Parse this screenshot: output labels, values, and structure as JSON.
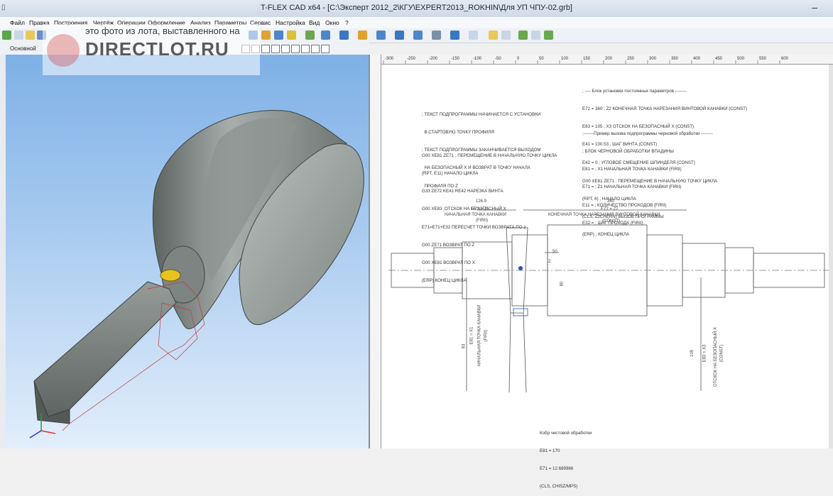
{
  "window": {
    "title": "T-FLEX CAD x64 - [С:\\Эксперт 2012_2\\КГУ\\EXPERT2013_ROKHIN\\Для УП ЧПУ-02.grb]",
    "minimize_glyph": "–"
  },
  "menu": {
    "items": [
      "Файл",
      "Правка",
      "Построения",
      "Чертёж",
      "Операции",
      "Оформление",
      "Анализ",
      "Параметры",
      "Сервис",
      "Настройка",
      "Вид",
      "Окно",
      "?"
    ]
  },
  "toolbar2": {
    "layer_label": "Основной"
  },
  "watermark": {
    "caption": "это фото из лота, выставленного на",
    "logo": "DIRECTLOT.RU"
  },
  "ruler": {
    "ticks": [
      "-300",
      "-250",
      "-200",
      "-150",
      "-100",
      "-50",
      "0",
      "50",
      "100",
      "150",
      "200",
      "250",
      "300",
      "350",
      "400",
      "450",
      "500",
      "550",
      "600"
    ]
  },
  "drawing": {
    "block1": [
      "; ТЕКСТ ПОДПРОГРАММЫ НАЧИНАЕТСЯ С УСТАНОВКИ",
      "  В СТАРТОВУЮ ТОЧКУ ПРОФИЛЯ",
      "; ТЕКСТ ПОДПРОГРАММЫ ЗАКАНЧИВАЕТСЯ ВЫХОДОМ",
      "  НА БЕЗОПАСНЫЙ Х И ВОЗВРАТ В ТОЧКУ НАЧАЛА",
      "  ПРОФИЛЯ ПО Z"
    ],
    "block2": [
      "G00 XE81 ZE71 ; ПЕРЕМЕЩЕНИЕ В НАЧАЛЬНУЮ ТОЧКУ ЦИКЛА",
      "(RPT, E11) НАЧАЛО ЦИКЛА",
      "G33 ZE72 KE41 RE42 НАРЕЗКА ВИНТА",
      "G00 XE83 ;ОТСКОК НА БЕЗОПАСНЫЙ Х",
      "E71=E71+E32 ПЕРЕСЧЕТ ТОЧКИ ВОЗВРАТА ПО z",
      "G00 ZE71 ВОЗВРАТ ПО Z",
      "G00 XE81 ВОЗВРАТ ПО X",
      "(ERP) КОНЕЦ ЦИКЛА"
    ],
    "block3": [
      "; ---- Блок установки постоянных параметров --------",
      "E72 = 360 ; Z2 КОНЕЧНАЯ ТОЧКА НАРЕЗАНИЯ ВИНТОВОЙ КАНАВКИ (CONST)",
      "E83 = 105 ; X3 ОТСКОК НА БЕЗОПАСНЫЙ Х (CONST)",
      "E41 = 100.53 ; ШАГ ВИНТА (CONST)",
      "E42 = 0 ; УГЛОВОЕ СМЕЩЕНИЕ ШПИНДЕЛЯ (CONST)"
    ],
    "block4": [
      ";-------Пример вызова подпрограммы черновой обработки --------",
      "; БЛОК ЧЕРНОВОЙ ОБРАБОТКИ ВПАДИНЫ",
      "E81 = ; X1 НАЧАЛЬНАЯ ТОЧКА КАНАВКИ (FIRII)",
      "E71 = ; Z1 НАЧАЛЬНАЯ ТОЧКА КАНАВКИ (FIRII)",
      "E11 = ; КОЛИЧЕСТВО ПРОХОДОВ (FIRII)",
      "E32 = ; ШАГ ПРОХОДА (FIRII)"
    ],
    "block5": [
      "G00 XE81 ZE71 ; ПЕРЕМЕЩЕНИЕ В НАЧАЛЬНУЮ ТОЧКУ ЦИКЛА",
      "(RPT, 6) ; НАЧАЛО ЦИКЛА",
      "(CLS, Z2CHERN) ВЫЗОВ ПРОГРАММЫ",
      "(ERP) ; КОНЕЦ ЦИКЛА"
    ],
    "block6": [
      "Кобр чистовой обработки",
      "E81 = 170",
      "E71 = 12.689986",
      "(CLS, CHISZ/MPS)"
    ],
    "dims": {
      "d1": "126.9",
      "d1a": "E71 = Z1",
      "d1b": "НАЧАЛЬНАЯ ТОЧКА КАНАВКИ",
      "d1c": "(FIRII)",
      "d2": "360",
      "d2a": "E72 = Z2",
      "d2b": "КОНЕЧНАЯ ТОЧКА НАРЕЗАНИЯ ВИНТОВОЙ КАНАВКИ",
      "d2c": "(CONST)",
      "d3": "50",
      "z": "Z",
      "d4": "93",
      "d4a": "E81 = X1",
      "d4b": "НАЧАЛЬНАЯ ТОЧКА КАНАВКИ",
      "d4c": "(FIRII)",
      "d5": "105",
      "d5a": "E83 = X3",
      "d5b": "ОТСКОК НА БЕЗОПАСНЫЙ Х",
      "d5c": "(CONST)",
      "d6": "80"
    }
  }
}
